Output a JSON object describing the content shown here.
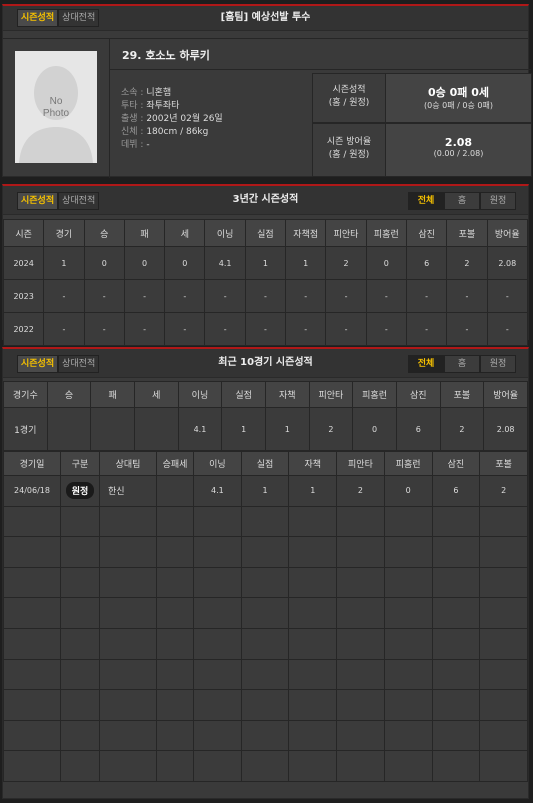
{
  "top": {
    "tabs": [
      "시즌성적",
      "상대전적"
    ],
    "title": "[홈팀] 예상선발 투수",
    "player_name": "29. 호소노 하루키",
    "photo_text": "No Photo",
    "info": [
      {
        "label": "소속",
        "value": "니혼햄"
      },
      {
        "label": "투타",
        "value": "좌투좌타"
      },
      {
        "label": "출생",
        "value": "2002년 02월 26일"
      },
      {
        "label": "신체",
        "value": "180cm / 86kg"
      },
      {
        "label": "데뷔",
        "value": "-"
      }
    ],
    "season_record_label": "시즌성적",
    "season_record_sub": "(홈 / 원정)",
    "season_record_value": "0승 0패 0세",
    "season_record_detail": "(0승 0패 / 0승 0패)",
    "era_label": "시즌 방어율",
    "era_sub": "(홈 / 원정)",
    "era_value": "2.08",
    "era_detail": "(0.00 / 2.08)"
  },
  "three_year": {
    "tabs": [
      "시즌성적",
      "상대전적"
    ],
    "title": "3년간 시즌성적",
    "filters": [
      "전체",
      "홈",
      "원정"
    ],
    "headers": [
      "시즌",
      "경기",
      "승",
      "패",
      "세",
      "이닝",
      "실점",
      "자책점",
      "피안타",
      "피홈런",
      "삼진",
      "포볼",
      "방어율"
    ],
    "rows": [
      [
        "2024",
        "1",
        "0",
        "0",
        "0",
        "4.1",
        "1",
        "1",
        "2",
        "0",
        "6",
        "2",
        "2.08"
      ],
      [
        "2023",
        "-",
        "-",
        "-",
        "-",
        "-",
        "-",
        "-",
        "-",
        "-",
        "-",
        "-",
        "-"
      ],
      [
        "2022",
        "-",
        "-",
        "-",
        "-",
        "-",
        "-",
        "-",
        "-",
        "-",
        "-",
        "-",
        "-"
      ]
    ]
  },
  "recent": {
    "tabs": [
      "시즌성적",
      "상대전적"
    ],
    "title": "최근 10경기 시즌성적",
    "filters": [
      "전체",
      "홈",
      "원정"
    ],
    "summary_headers": [
      "경기수",
      "승",
      "패",
      "세",
      "이닝",
      "실점",
      "자책",
      "피안타",
      "피홈런",
      "삼진",
      "포볼",
      "방어율"
    ],
    "summary_row": [
      "1경기",
      "",
      "",
      "",
      "4.1",
      "1",
      "1",
      "2",
      "0",
      "6",
      "2",
      "2.08"
    ],
    "game_headers": [
      "경기일",
      "구분",
      "상대팀",
      "승패세",
      "이닝",
      "실점",
      "자책",
      "피안타",
      "피홈런",
      "삼진",
      "포볼"
    ],
    "games": [
      [
        "24/06/18",
        "원정",
        "한신",
        "",
        "4.1",
        "1",
        "1",
        "2",
        "0",
        "6",
        "2"
      ]
    ]
  },
  "colors": {
    "accent": "#f5c000",
    "top_border": "#b01818",
    "panel": "#3a3a3a"
  }
}
